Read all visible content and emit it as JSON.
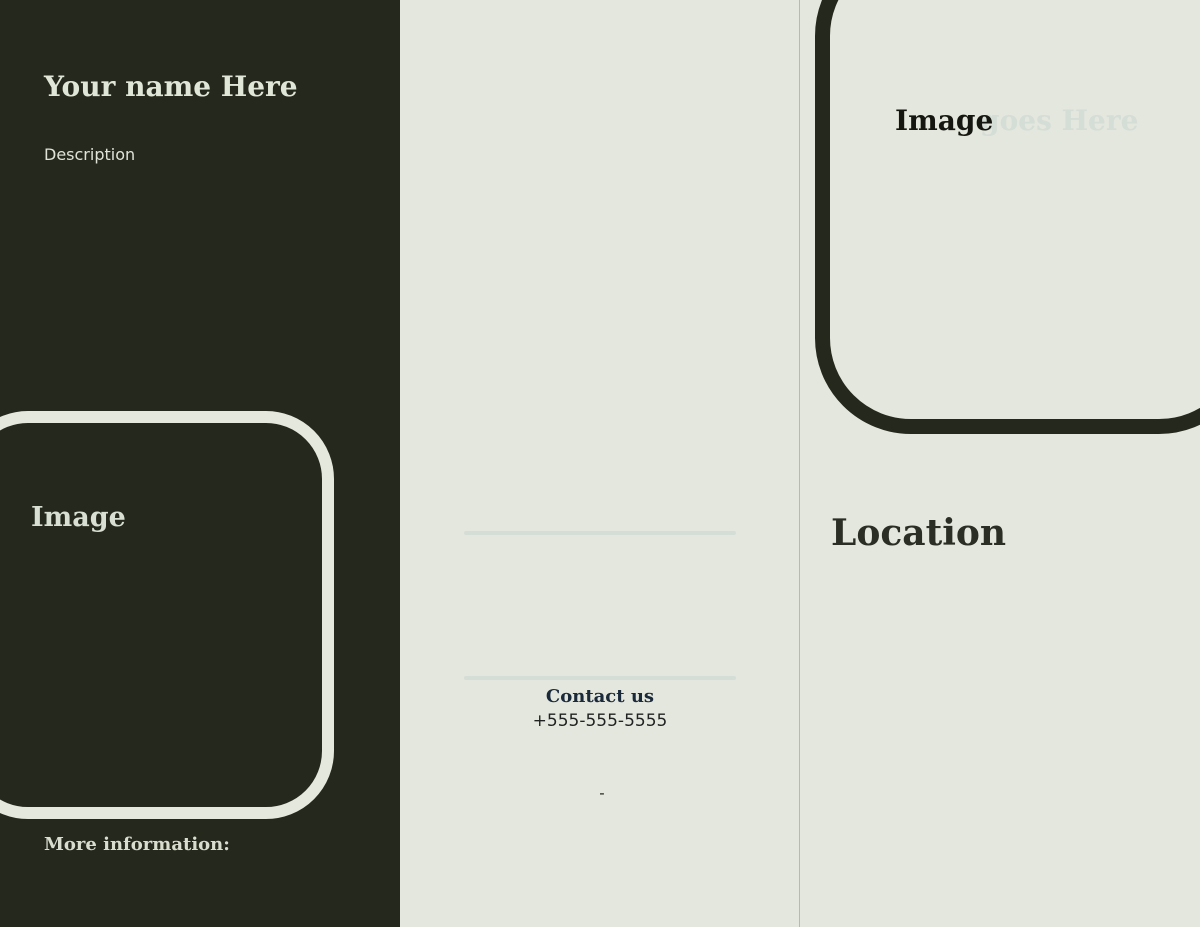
{
  "left_panel": {
    "name": "Your name Here",
    "description": "Description",
    "image_label": "Image",
    "more_info": "More information:"
  },
  "middle_panel": {
    "contact_heading": "Contact us",
    "contact_phone": "+555-555-5555",
    "dash": "-"
  },
  "right_panel": {
    "image_label": "Image",
    "image_label_faded": "goes Here",
    "location_title": "Location"
  },
  "colors": {
    "dark_panel": "#25291d",
    "light_panel": "#e4e7dd",
    "accent_light": "#e5e8dc",
    "contact_heading": "#1b2a3b"
  }
}
